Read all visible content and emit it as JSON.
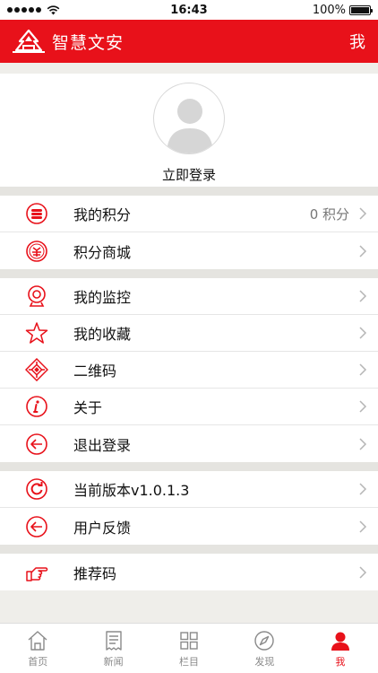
{
  "status_bar": {
    "time": "16:43",
    "battery": "100%",
    "battery_level": 1.0
  },
  "header": {
    "title": "智慧文安",
    "right_label": "我",
    "logo_icon": "temple-logo-icon"
  },
  "profile": {
    "login_label": "立即登录",
    "avatar_icon": "default-avatar-icon"
  },
  "groups": [
    {
      "items": [
        {
          "icon": "points-coins-icon",
          "label": "我的积分",
          "value": "0 积分"
        },
        {
          "icon": "points-mall-icon",
          "label": "积分商城"
        }
      ]
    },
    {
      "items": [
        {
          "icon": "webcam-icon",
          "label": "我的监控"
        },
        {
          "icon": "star-icon",
          "label": "我的收藏"
        },
        {
          "icon": "qrcode-icon",
          "label": "二维码"
        },
        {
          "icon": "info-icon",
          "label": "关于"
        },
        {
          "icon": "logout-icon",
          "label": "退出登录"
        }
      ]
    },
    {
      "items": [
        {
          "icon": "refresh-icon",
          "label": "当前版本v1.0.1.3"
        },
        {
          "icon": "feedback-icon",
          "label": "用户反馈"
        }
      ]
    },
    {
      "items": [
        {
          "icon": "pointing-hand-icon",
          "label": "推荐码"
        }
      ]
    }
  ],
  "tabs": [
    {
      "icon": "home-icon",
      "label": "首页",
      "active": false
    },
    {
      "icon": "news-icon",
      "label": "新闻",
      "active": false
    },
    {
      "icon": "grid-icon",
      "label": "栏目",
      "active": false
    },
    {
      "icon": "compass-icon",
      "label": "发现",
      "active": false
    },
    {
      "icon": "user-icon",
      "label": "我",
      "active": true
    }
  ],
  "colors": {
    "brand_red": "#e8111a",
    "background": "#efeeea",
    "separator": "#e5e4e0"
  }
}
